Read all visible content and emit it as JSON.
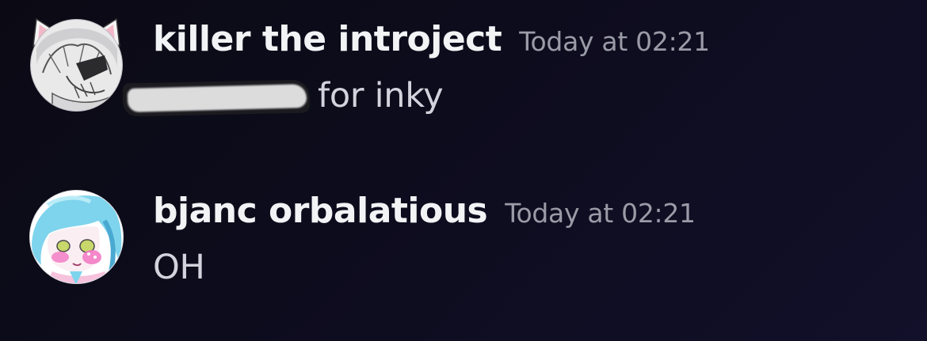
{
  "messages": [
    {
      "username": "killer the introject",
      "timestamp": "Today at 02:21",
      "avatar_icon": "cat-ear-character-avatar",
      "content_redacted": true,
      "content_text": "for inky"
    },
    {
      "username": "bjanc orbalatious",
      "timestamp": "Today at 02:21",
      "avatar_icon": "blue-hair-character-avatar",
      "content_redacted": false,
      "content_text": "OH"
    }
  ],
  "colors": {
    "background": "#0d0c1d",
    "username": "#f2f3f5",
    "timestamp": "#9a9ba7",
    "message_text": "#d2d3dc",
    "redaction_mark": "#dcdcdc"
  }
}
